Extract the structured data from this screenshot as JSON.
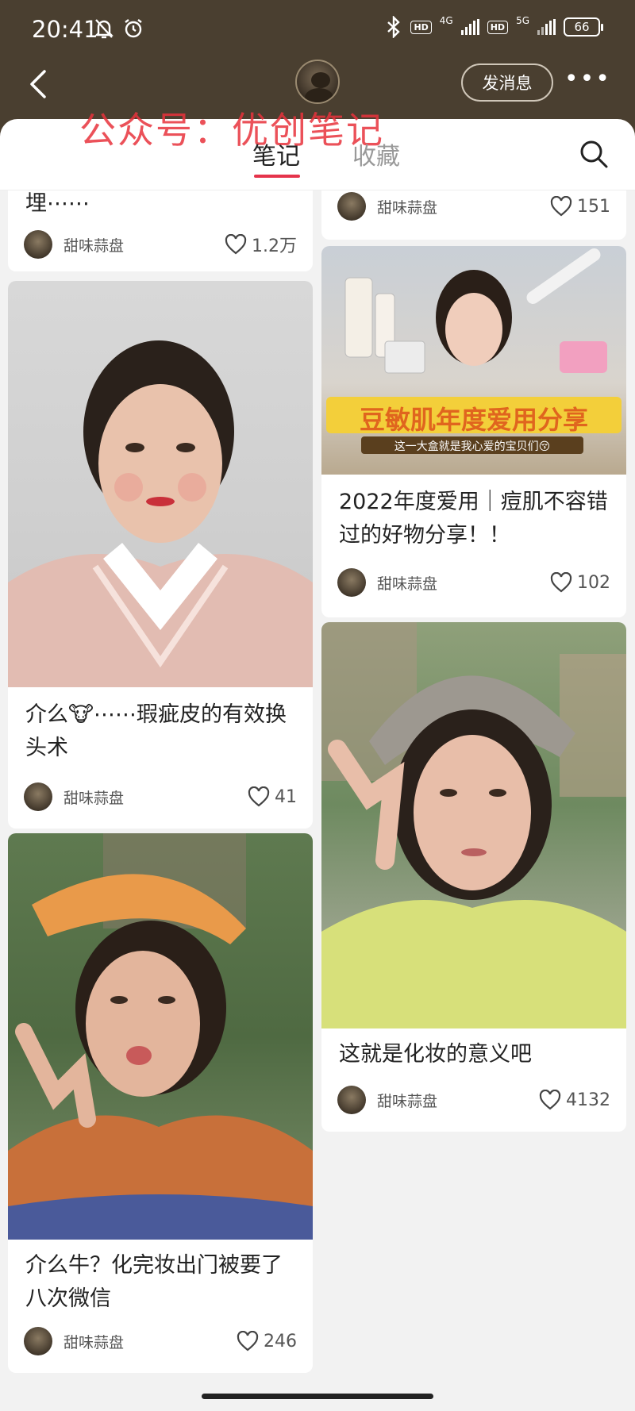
{
  "status_bar": {
    "time": "20:41",
    "network_1": "4G",
    "network_2": "5G",
    "hd_label": "HD",
    "battery": "66"
  },
  "header": {
    "send_message_label": "发消息",
    "more_label": "•••"
  },
  "tabs": {
    "notes": "笔记",
    "collections": "收藏"
  },
  "watermark": "公众号：优创笔记",
  "feed": {
    "left": [
      {
        "title": "埋⋯⋯",
        "author": "甜味蒜盘",
        "likes": "1.2万"
      },
      {
        "title": "介么🐮⋯⋯瑕疵皮的有效换头术",
        "author": "甜味蒜盘",
        "likes": "41"
      },
      {
        "title": "介么牛？化完妆出门被要了八次微信",
        "author": "甜味蒜盘",
        "likes": "246"
      }
    ],
    "right": [
      {
        "title": "",
        "author": "甜味蒜盘",
        "likes": "151"
      },
      {
        "title": "2022年度爱用｜痘肌不容错过的好物分享！！",
        "author": "甜味蒜盘",
        "likes": "102",
        "image_banner": "豆敏肌年度爱用分享",
        "image_subbanner": "这一大盒就是我心爱的宝贝们😚"
      },
      {
        "title": "这就是化妆的意义吧",
        "author": "甜味蒜盘",
        "likes": "4132"
      }
    ]
  }
}
